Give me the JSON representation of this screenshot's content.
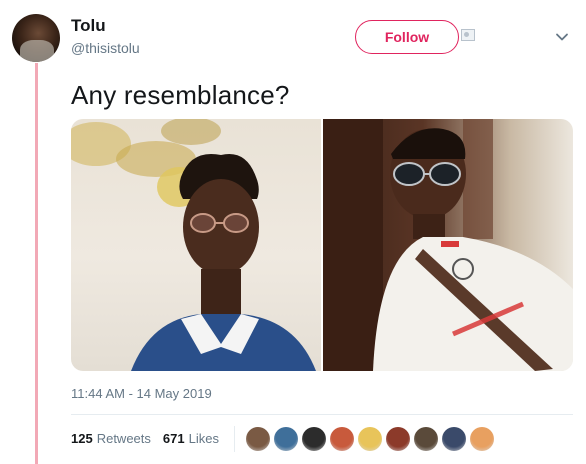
{
  "user": {
    "name": "Tolu",
    "handle": "@thisistolu"
  },
  "actions": {
    "follow_label": "Follow"
  },
  "tweet": {
    "text": "Any resemblance?",
    "timestamp": "11:44 AM - 14 May 2019"
  },
  "stats": {
    "retweets_count": "125",
    "retweets_label": "Retweets",
    "likes_count": "671",
    "likes_label": "Likes"
  },
  "colors": {
    "accent": "#e0245e",
    "thread_line": "#f2a9b6",
    "secondary_text": "#657786"
  },
  "likers": [
    {
      "color": "#7a5a44"
    },
    {
      "color": "#3f6f9a"
    },
    {
      "color": "#2c2c2c"
    },
    {
      "color": "#c85a3c"
    },
    {
      "color": "#e8c45a"
    },
    {
      "color": "#8c3a2a"
    },
    {
      "color": "#5a4a3a"
    },
    {
      "color": "#3a4a6a"
    },
    {
      "color": "#e8a060"
    }
  ]
}
